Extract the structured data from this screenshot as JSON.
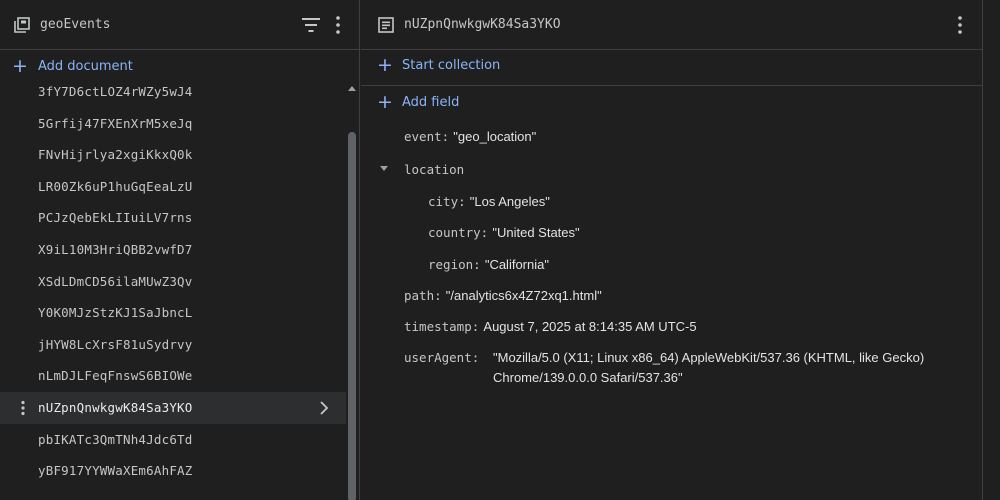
{
  "collection": {
    "title": "geoEvents",
    "add_label": "Add document",
    "docs": [
      "3fY7D6ctLOZ4rWZy5wJ4",
      "5Grfij47FXEnXrM5xeJq",
      "FNvHijrlya2xgiKkxQ0k",
      "LR00Zk6uP1huGqEeaLzU",
      "PCJzQebEkLIIuiLV7rns",
      "X9iL10M3HriQBB2vwfD7",
      "XSdLDmCD56ilaMUwZ3Qv",
      "Y0K0MJzStzKJ1SaJbncL",
      "jHYW8LcXrsF81uSydrvy",
      "nLmDJLFeqFnswS6BIOWe",
      "nUZpnQnwkgwK84Sa3YKO",
      "pbIKATc3QmTNh4Jdc6Td",
      "yBF917YYWWaXEm6AhFAZ"
    ],
    "selected_index": 10
  },
  "document": {
    "title": "nUZpnQnwkgwK84Sa3YKO",
    "start_collection_label": "Start collection",
    "add_field_label": "Add field",
    "fields": {
      "event_key": "event:",
      "event_val": "\"geo_location\"",
      "location_key": "location",
      "city_key": "city:",
      "city_val": "\"Los Angeles\"",
      "country_key": "country:",
      "country_val": "\"United States\"",
      "region_key": "region:",
      "region_val": "\"California\"",
      "path_key": "path:",
      "path_val": "\"/analytics6x4Z72xq1.html\"",
      "timestamp_key": "timestamp:",
      "timestamp_val": "August 7, 2025 at 8:14:35 AM UTC-5",
      "useragent_key": "userAgent:",
      "useragent_val_line1": "\"Mozilla/5.0 (X11; Linux x86_64) AppleWebKit/537.36 (KHTML, like Gecko)",
      "useragent_val_line2": "Chrome/139.0.0.0 Safari/537.36\""
    }
  },
  "colors": {
    "background": "#1f1f1f",
    "accent": "#8ab4f8",
    "divider": "#3c4043",
    "selected_row": "#2d2e30"
  }
}
